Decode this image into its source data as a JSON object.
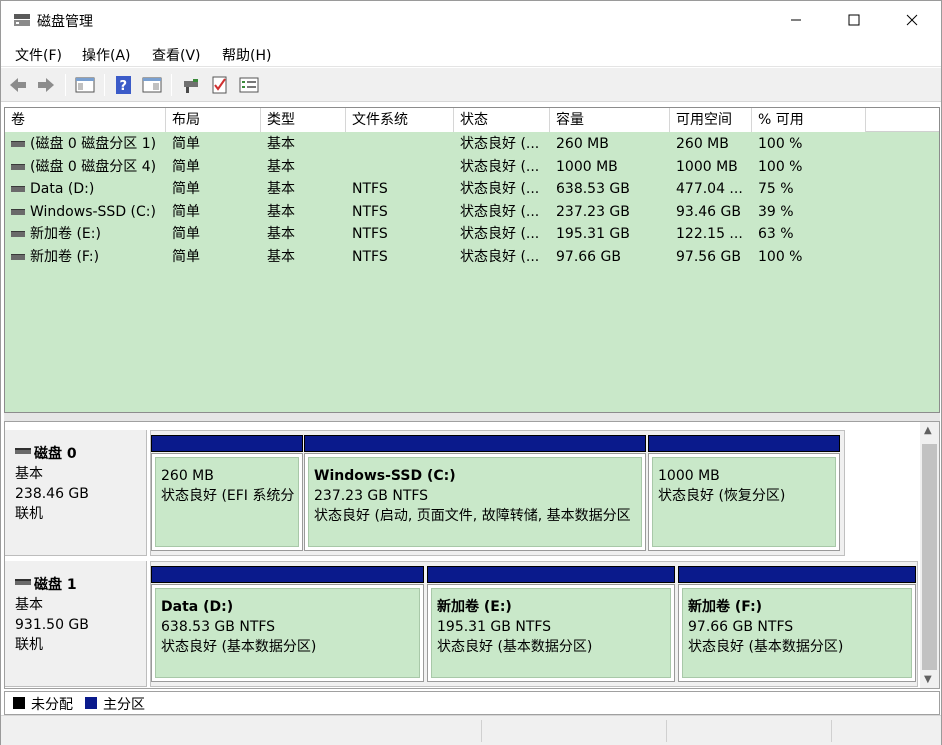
{
  "window": {
    "title": "磁盘管理"
  },
  "menu": [
    "文件(F)",
    "操作(A)",
    "查看(V)",
    "帮助(H)"
  ],
  "toolbar_icons": [
    "back-arrow-icon",
    "forward-arrow-icon",
    "console-tree-icon",
    "help-icon",
    "properties-icon",
    "connect-icon",
    "check-icon",
    "list-view-icon"
  ],
  "columns": [
    "卷",
    "布局",
    "类型",
    "文件系统",
    "状态",
    "容量",
    "可用空间",
    "% 可用"
  ],
  "volumes": [
    {
      "name": "(磁盘 0 磁盘分区 1)",
      "layout": "简单",
      "type": "基本",
      "fs": "",
      "status": "状态良好 (...",
      "capacity": "260 MB",
      "free": "260 MB",
      "pct": "100 %"
    },
    {
      "name": "(磁盘 0 磁盘分区 4)",
      "layout": "简单",
      "type": "基本",
      "fs": "",
      "status": "状态良好 (...",
      "capacity": "1000 MB",
      "free": "1000 MB",
      "pct": "100 %"
    },
    {
      "name": "Data (D:)",
      "layout": "简单",
      "type": "基本",
      "fs": "NTFS",
      "status": "状态良好 (...",
      "capacity": "638.53 GB",
      "free": "477.04 ...",
      "pct": "75 %"
    },
    {
      "name": "Windows-SSD (C:)",
      "layout": "简单",
      "type": "基本",
      "fs": "NTFS",
      "status": "状态良好 (...",
      "capacity": "237.23 GB",
      "free": "93.46 GB",
      "pct": "39 %"
    },
    {
      "name": "新加卷 (E:)",
      "layout": "简单",
      "type": "基本",
      "fs": "NTFS",
      "status": "状态良好 (...",
      "capacity": "195.31 GB",
      "free": "122.15 ...",
      "pct": "63 %"
    },
    {
      "name": "新加卷 (F:)",
      "layout": "简单",
      "type": "基本",
      "fs": "NTFS",
      "status": "状态良好 (...",
      "capacity": "97.66 GB",
      "free": "97.56 GB",
      "pct": "100 %"
    }
  ],
  "disks": [
    {
      "name": "磁盘 0",
      "kind": "基本",
      "size": "238.46 GB",
      "state": "联机",
      "partitions": [
        {
          "title": "",
          "size": "260 MB",
          "status": "状态良好 (EFI 系统分"
        },
        {
          "title": "Windows-SSD  (C:)",
          "size": "237.23 GB NTFS",
          "status": "状态良好 (启动, 页面文件, 故障转储, 基本数据分区"
        },
        {
          "title": "",
          "size": "1000 MB",
          "status": "状态良好 (恢复分区)"
        }
      ]
    },
    {
      "name": "磁盘 1",
      "kind": "基本",
      "size": "931.50 GB",
      "state": "联机",
      "partitions": [
        {
          "title": "Data  (D:)",
          "size": "638.53 GB NTFS",
          "status": "状态良好 (基本数据分区)"
        },
        {
          "title": "新加卷  (E:)",
          "size": "195.31 GB NTFS",
          "status": "状态良好 (基本数据分区)"
        },
        {
          "title": "新加卷  (F:)",
          "size": "97.66 GB NTFS",
          "status": "状态良好 (基本数据分区)"
        }
      ]
    }
  ],
  "legend": {
    "unallocated": "未分配",
    "primary": "主分区"
  },
  "colors": {
    "primary_partition": "#0a1a8c",
    "unallocated": "#000000",
    "volume_bg": "#c9e8c9"
  }
}
